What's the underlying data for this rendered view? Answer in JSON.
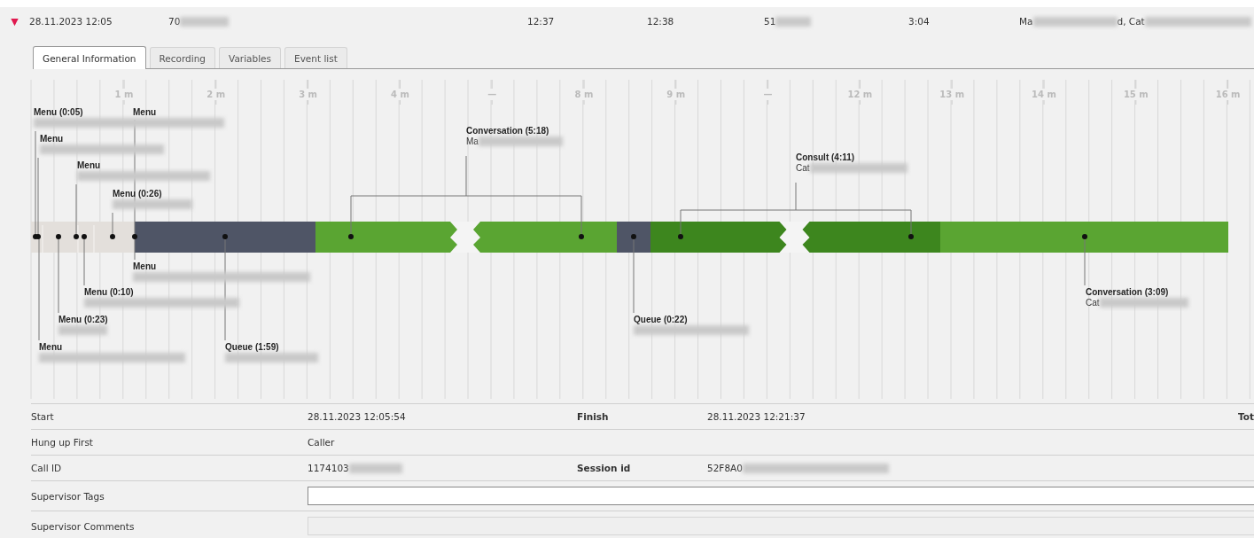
{
  "header": {
    "toggle": "▼",
    "expanded": true,
    "cells": [
      {
        "parts": [
          {
            "text": "28.11.2023 12:05",
            "redacted": false
          }
        ]
      },
      {
        "parts": [
          {
            "text": "70",
            "redacted": true
          }
        ]
      },
      {
        "parts": [
          {
            "text": "12:37",
            "redacted": false
          }
        ]
      },
      {
        "parts": [
          {
            "text": "12:38",
            "redacted": false
          }
        ]
      },
      {
        "parts": [
          {
            "text": "51",
            "redacted": true
          }
        ]
      },
      {
        "parts": [
          {
            "text": "3:04",
            "redacted": false
          }
        ]
      },
      {
        "parts": [
          {
            "text": "Ma",
            "redacted": true
          },
          {
            "text": "d, Cat",
            "redacted": true
          }
        ]
      }
    ]
  },
  "tabs": [
    {
      "label": "General Information",
      "selected": true
    },
    {
      "label": "Recording",
      "selected": false
    },
    {
      "label": "Variables",
      "selected": false
    },
    {
      "label": "Event list",
      "selected": false
    }
  ],
  "timeline": {
    "axis_labels": [
      "1 m",
      "2 m",
      "3 m",
      "4 m",
      "—",
      "8 m",
      "9 m",
      "—",
      "12 m",
      "13 m",
      "14 m",
      "15 m",
      "16 m"
    ],
    "segments": [
      {
        "kind": "menu",
        "gap": false
      },
      {
        "kind": "queue",
        "gap": false
      },
      {
        "kind": "conversation",
        "gap": true
      },
      {
        "kind": "queue",
        "gap": false
      },
      {
        "kind": "consult",
        "gap": true
      },
      {
        "kind": "conversation",
        "gap": false
      }
    ],
    "callouts": [
      {
        "title": "Menu (0:05)",
        "redacted": true
      },
      {
        "title": "Menu",
        "redacted": false
      },
      {
        "title": "Menu",
        "redacted": true
      },
      {
        "title": "Conversation (5:18)",
        "detail": "Ma",
        "redacted": true
      },
      {
        "title": "Menu",
        "redacted": true
      },
      {
        "title": "Consult (4:11)",
        "detail": "Cat",
        "redacted": true
      },
      {
        "title": "Menu (0:26)",
        "redacted": true
      },
      {
        "title": "Menu",
        "redacted": true
      },
      {
        "title": "Menu (0:10)",
        "redacted": true
      },
      {
        "title": "Conversation (3:09)",
        "detail": "Cat",
        "redacted": true
      },
      {
        "title": "Menu (0:23)",
        "redacted": true
      },
      {
        "title": "Queue (0:22)",
        "redacted": true
      },
      {
        "title": "Menu",
        "redacted": true
      },
      {
        "title": "Queue (1:59)",
        "redacted": true
      }
    ]
  },
  "details": [
    {
      "kind": "text",
      "label": "Start",
      "value": "28.11.2023 12:05:54",
      "label2": "Finish",
      "value2": "28.11.2023 12:21:37",
      "label3": "Tot"
    },
    {
      "kind": "text",
      "label": "Hung up First",
      "value": "Caller"
    },
    {
      "kind": "text",
      "label": "Call ID",
      "value": "1174103",
      "redacted": true,
      "label2": "Session id",
      "value2": "52F8A0",
      "redacted2": true
    },
    {
      "kind": "field",
      "label": "Supervisor Tags",
      "disabled": false
    },
    {
      "kind": "field",
      "label": "Supervisor Comments",
      "disabled": true
    }
  ]
}
